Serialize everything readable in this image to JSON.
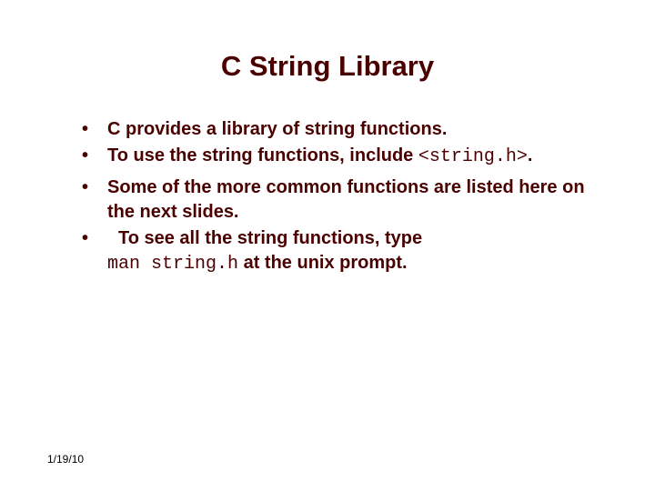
{
  "title": "C String Library",
  "bullets": {
    "b1": "C provides a library of string functions.",
    "b2_pre": "To use the string functions, include ",
    "b2_code": "<string.h>",
    "b2_post": ".",
    "b3": "Some of the more common functions are listed here on the next slides.",
    "b4_pre": " To see all the string functions, type ",
    "b4_code": "man string.h",
    "b4_post": " at the unix prompt."
  },
  "footer": "1/19/10"
}
